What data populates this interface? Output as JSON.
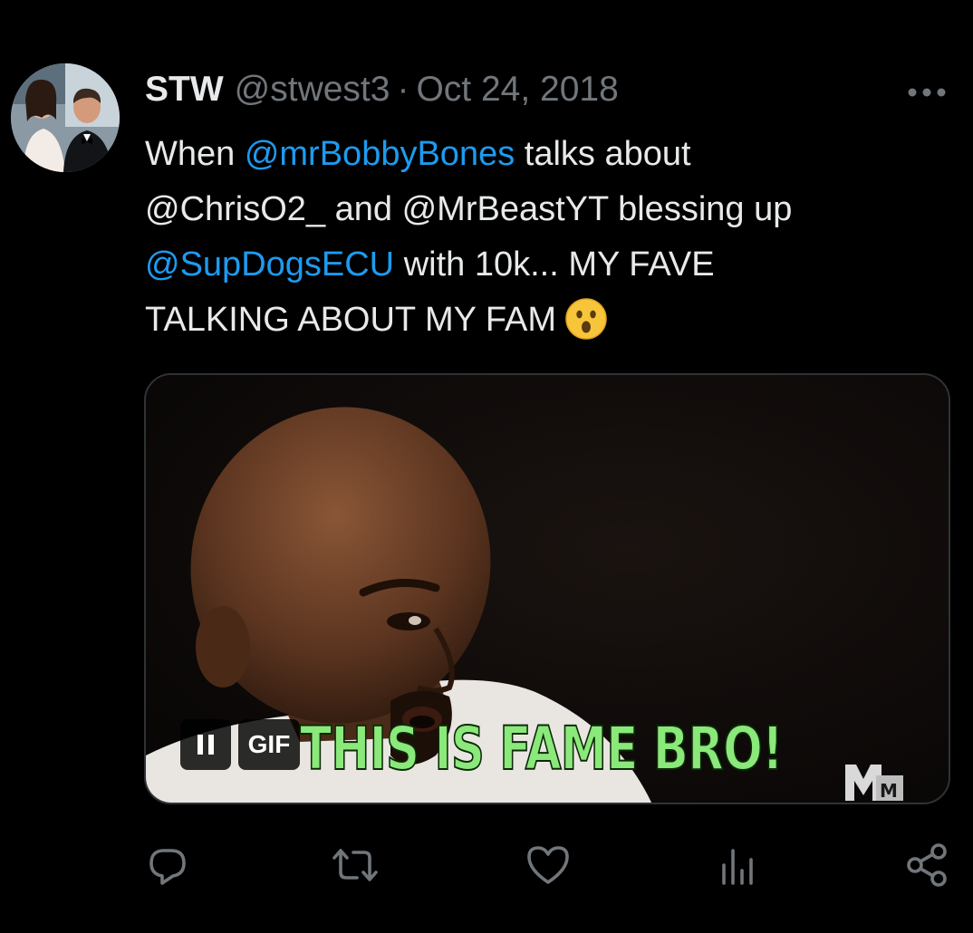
{
  "tweet": {
    "display_name": "STW",
    "handle": "@stwest3",
    "separator": "·",
    "date": "Oct 24, 2018",
    "text": {
      "line1_prefix": "When ",
      "line1_mention": "@mrBobbyBones",
      "line1_suffix": " talks about",
      "line2_mention1": "@ChrisO2_",
      "line2_middle": " and ",
      "line2_mention2": "@MrBeastYT",
      "line2_suffix": " blessing up",
      "line3_mention": "@SupDogsECU",
      "line3_suffix": " with 10k... MY FAVE",
      "line4": "TALKING ABOUT MY FAM"
    },
    "media": {
      "caption": "THIS IS FAME BRO!",
      "gif_label": "GIF"
    }
  },
  "colors": {
    "background": "#000000",
    "text": "#e7e9ea",
    "secondary": "#71767b",
    "link": "#1d9bf0",
    "caption_green": "#8be87a"
  },
  "icons": {
    "more": "more-dots-icon",
    "reply": "reply-icon",
    "retweet": "retweet-icon",
    "like": "heart-icon",
    "views": "views-chart-icon",
    "share": "share-icon",
    "pause": "pause-icon",
    "emoji": "astonished-face-emoji"
  }
}
